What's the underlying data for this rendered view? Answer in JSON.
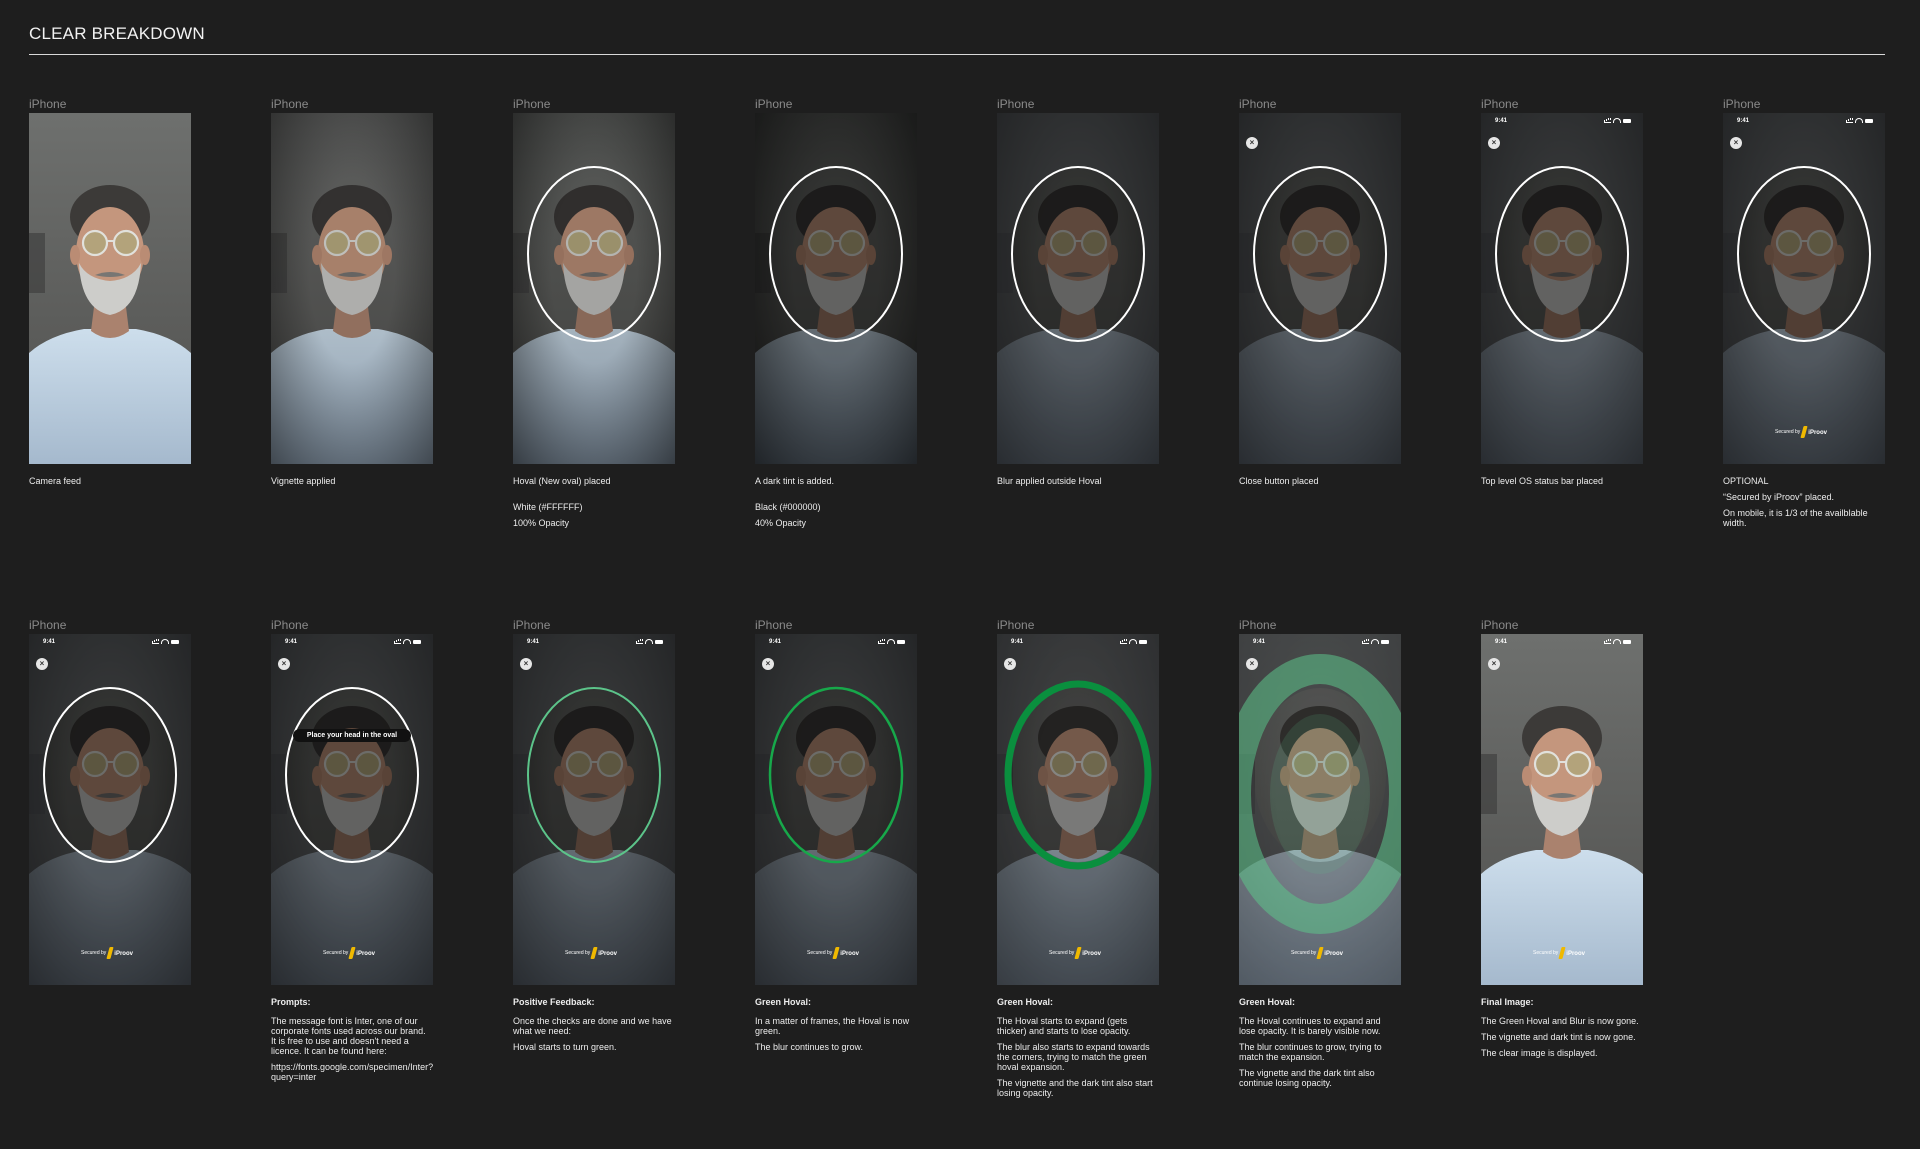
{
  "page": {
    "title": "CLEAR BREAKDOWN",
    "device_label": "iPhone",
    "status_time": "9:41",
    "secured_text": "Secured by",
    "logo_text": "iProov",
    "prompt_text": "Place your head in the oval",
    "close_glyph": "×"
  },
  "colors": {
    "background": "#1e1e1e",
    "oval_white": "#ffffff",
    "oval_green_light": "#5cc48a",
    "oval_green": "#17a84a",
    "oval_green_dark": "#0a8f3e",
    "tint": "#000000"
  },
  "row1": [
    {
      "lines": [
        "Camera feed"
      ]
    },
    {
      "lines": [
        "Vignette applied"
      ]
    },
    {
      "lines": [
        "Hoval (New oval) placed",
        "",
        "White (#FFFFFF)",
        "100% Opacity"
      ]
    },
    {
      "lines": [
        "A dark tint is added.",
        "",
        "Black (#000000)",
        "40% Opacity"
      ]
    },
    {
      "lines": [
        "Blur applied outside Hoval"
      ]
    },
    {
      "lines": [
        "Close button placed"
      ]
    },
    {
      "lines": [
        "Top level OS status bar placed"
      ]
    },
    {
      "lines": [
        "OPTIONAL",
        "“Secured by iProov” placed.",
        "On mobile, it is 1/3 of the availblable width."
      ]
    }
  ],
  "row2": [
    {
      "heading": "",
      "paras": []
    },
    {
      "heading": "Prompts:",
      "paras": [
        "The message font is Inter, one of our corporate fonts used across our brand. It is free to use and doesn't need a licence. It can be found here:",
        "https://fonts.google.com/specimen/Inter?query=inter"
      ]
    },
    {
      "heading": "Positive Feedback:",
      "paras": [
        "Once the checks are done and we have what we need:",
        "Hoval starts to turn green."
      ]
    },
    {
      "heading": "Green Hoval:",
      "paras": [
        "In a matter of frames, the Hoval is now green.",
        "The blur continues to grow."
      ]
    },
    {
      "heading": "Green Hoval:",
      "paras": [
        "The Hoval starts to expand (gets thicker) and starts to lose opacity.",
        "The blur also starts to expand towards the corners, trying to match the green hoval expansion.",
        "The vignette and the dark tint also start losing opacity."
      ]
    },
    {
      "heading": "Green Hoval:",
      "paras": [
        "The Hoval continues to expand and lose opacity. It is barely visible now.",
        "The blur continues to grow, trying to match the expansion.",
        "The vignette and the dark tint also continue losing opacity."
      ]
    },
    {
      "heading": "Final Image:",
      "paras": [
        "The Green Hoval and Blur is now gone.",
        "The vignette and dark tint is now gone.",
        "The clear image is displayed."
      ]
    }
  ]
}
